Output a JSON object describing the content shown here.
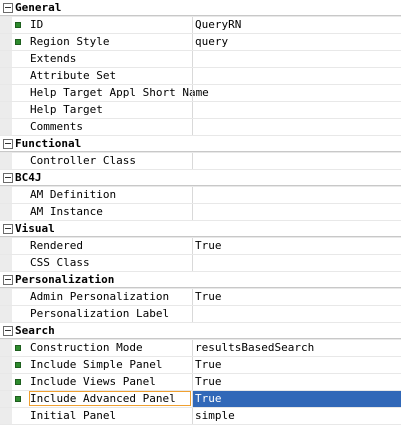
{
  "colors": {
    "selection": "#3168b8",
    "marker": "#2e8b2e",
    "focus_outline": "#f0a030"
  },
  "rows": [
    {
      "type": "category",
      "label": "General"
    },
    {
      "type": "prop",
      "label": "ID",
      "value": "QueryRN",
      "marker": true
    },
    {
      "type": "prop",
      "label": "Region Style",
      "value": "query",
      "marker": true
    },
    {
      "type": "prop",
      "label": "Extends",
      "value": "",
      "marker": false
    },
    {
      "type": "prop",
      "label": "Attribute Set",
      "value": "",
      "marker": false
    },
    {
      "type": "prop",
      "label": "Help Target Appl Short Name",
      "value": "",
      "marker": false
    },
    {
      "type": "prop",
      "label": "Help Target",
      "value": "",
      "marker": false
    },
    {
      "type": "prop",
      "label": "Comments",
      "value": "",
      "marker": false
    },
    {
      "type": "category",
      "label": "Functional"
    },
    {
      "type": "prop",
      "label": "Controller Class",
      "value": "",
      "marker": false
    },
    {
      "type": "category",
      "label": "BC4J"
    },
    {
      "type": "prop",
      "label": "AM Definition",
      "value": "",
      "marker": false
    },
    {
      "type": "prop",
      "label": "AM Instance",
      "value": "",
      "marker": false
    },
    {
      "type": "category",
      "label": "Visual"
    },
    {
      "type": "prop",
      "label": "Rendered",
      "value": "True",
      "marker": false
    },
    {
      "type": "prop",
      "label": "CSS Class",
      "value": "",
      "marker": false
    },
    {
      "type": "category",
      "label": "Personalization"
    },
    {
      "type": "prop",
      "label": "Admin Personalization",
      "value": "True",
      "marker": false
    },
    {
      "type": "prop",
      "label": "Personalization Label",
      "value": "",
      "marker": false
    },
    {
      "type": "category",
      "label": "Search"
    },
    {
      "type": "prop",
      "label": "Construction Mode",
      "value": "resultsBasedSearch",
      "marker": true
    },
    {
      "type": "prop",
      "label": "Include Simple Panel",
      "value": "True",
      "marker": true
    },
    {
      "type": "prop",
      "label": "Include Views Panel",
      "value": "True",
      "marker": true
    },
    {
      "type": "prop",
      "label": "Include Advanced Panel",
      "value": "True",
      "marker": true,
      "selected": true
    },
    {
      "type": "prop",
      "label": "Initial Panel",
      "value": "simple",
      "marker": false
    }
  ]
}
